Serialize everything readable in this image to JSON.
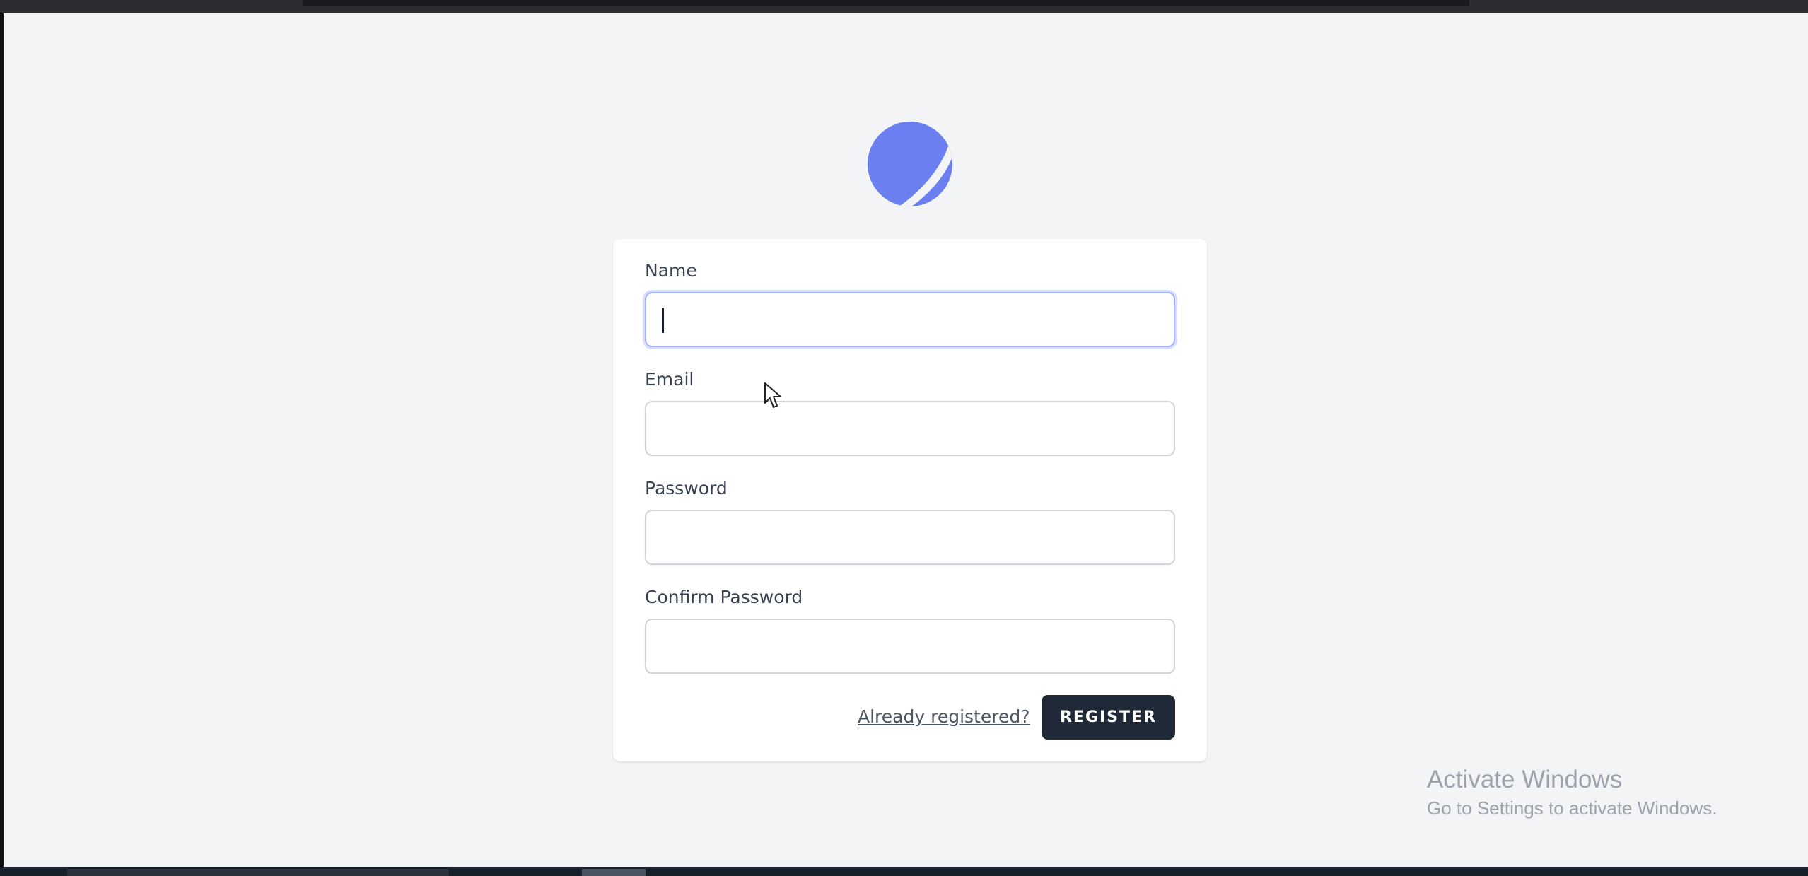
{
  "form": {
    "name_label": "Name",
    "name_value": "",
    "email_label": "Email",
    "email_value": "",
    "password_label": "Password",
    "password_value": "",
    "confirm_password_label": "Confirm Password",
    "confirm_password_value": "",
    "already_registered_link": "Already registered?",
    "register_button": "REGISTER"
  },
  "logo": {
    "icon": "planet-logo-icon",
    "color": "#6b7ff0"
  },
  "watermark": {
    "title": "Activate Windows",
    "subtitle": "Go to Settings to activate Windows."
  },
  "colors": {
    "background": "#f3f4f6",
    "card": "#ffffff",
    "button": "#1f2937",
    "focus_ring": "#a5b4fc"
  }
}
